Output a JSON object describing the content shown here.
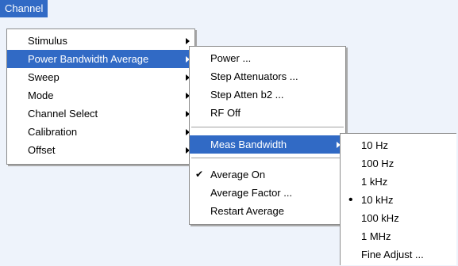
{
  "menubar": {
    "channel_label": "Channel"
  },
  "channel_menu": {
    "items": [
      {
        "label": "Stimulus"
      },
      {
        "label": "Power Bandwidth Average"
      },
      {
        "label": "Sweep"
      },
      {
        "label": "Mode"
      },
      {
        "label": "Channel Select"
      },
      {
        "label": "Calibration"
      },
      {
        "label": "Offset"
      }
    ]
  },
  "pba_menu": {
    "items": [
      {
        "label": "Power ..."
      },
      {
        "label": "Step Attenuators ..."
      },
      {
        "label": "Step Atten b2 ..."
      },
      {
        "label": "RF Off"
      },
      {
        "label": "Meas Bandwidth"
      },
      {
        "label": "Average On",
        "checked": true
      },
      {
        "label": "Average Factor ..."
      },
      {
        "label": "Restart Average"
      }
    ]
  },
  "bandwidth_menu": {
    "items": [
      {
        "label": "10 Hz"
      },
      {
        "label": "100 Hz"
      },
      {
        "label": "1 kHz"
      },
      {
        "label": "10 kHz",
        "selected": true
      },
      {
        "label": "100 kHz"
      },
      {
        "label": "1 MHz"
      },
      {
        "label": "Fine Adjust ..."
      }
    ]
  },
  "colors": {
    "highlight": "#316ac5",
    "background": "#eef3fb"
  }
}
